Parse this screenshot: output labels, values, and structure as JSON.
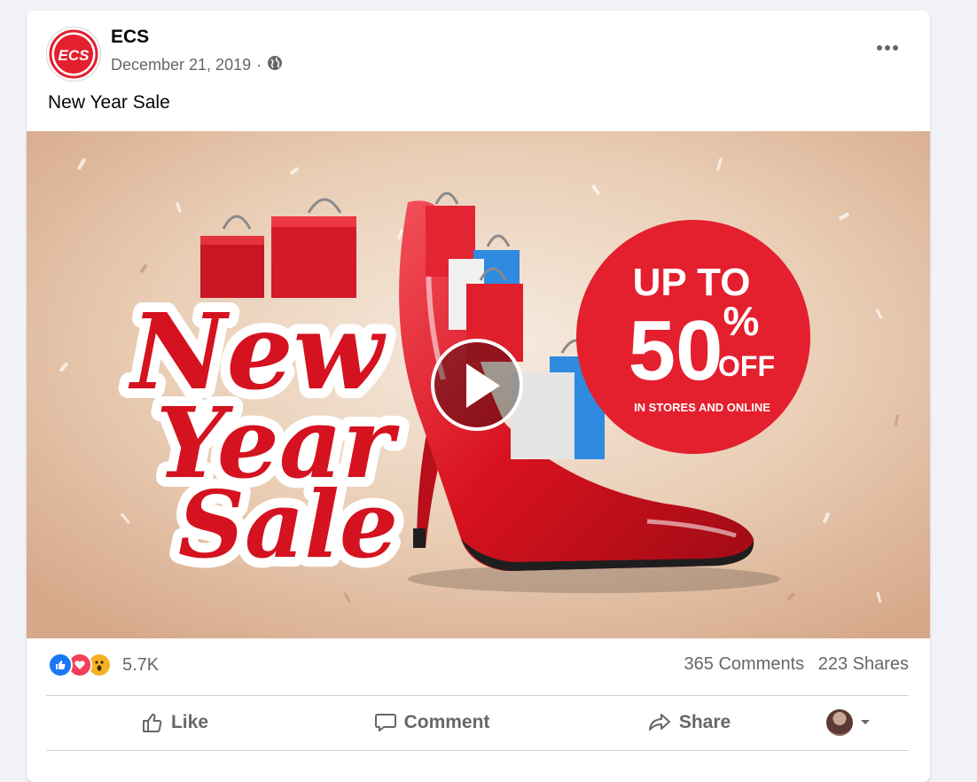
{
  "post": {
    "page_name": "ECS",
    "date": "December 21, 2019",
    "separator": "·",
    "privacy_icon": "globe-icon",
    "more_icon": "more-horizontal-icon",
    "text": "New Year Sale",
    "logo_text": "ECS"
  },
  "media": {
    "type": "video",
    "play_icon": "play-icon",
    "script_words": [
      "New",
      "Year",
      "Sale"
    ],
    "badge": {
      "line1": "UP TO",
      "percent": "50",
      "percent_sign": "%",
      "off": "OFF",
      "subtext": "IN STORES AND ONLINE"
    },
    "colors": {
      "background": "#e9cdb4",
      "red": "#e41f2e",
      "blue": "#2f8be0"
    }
  },
  "stats": {
    "reaction_icons": [
      "like-reaction-icon",
      "love-reaction-icon",
      "wow-reaction-icon"
    ],
    "reaction_count": "5.7K",
    "comments": "365 Comments",
    "shares": "223 Shares"
  },
  "actions": {
    "like_label": "Like",
    "comment_label": "Comment",
    "share_label": "Share"
  },
  "colors": {
    "like_blue": "#1877f2",
    "love_red": "#f33e58",
    "wow_yellow": "#f7b125",
    "secondary_text": "#65676b"
  }
}
